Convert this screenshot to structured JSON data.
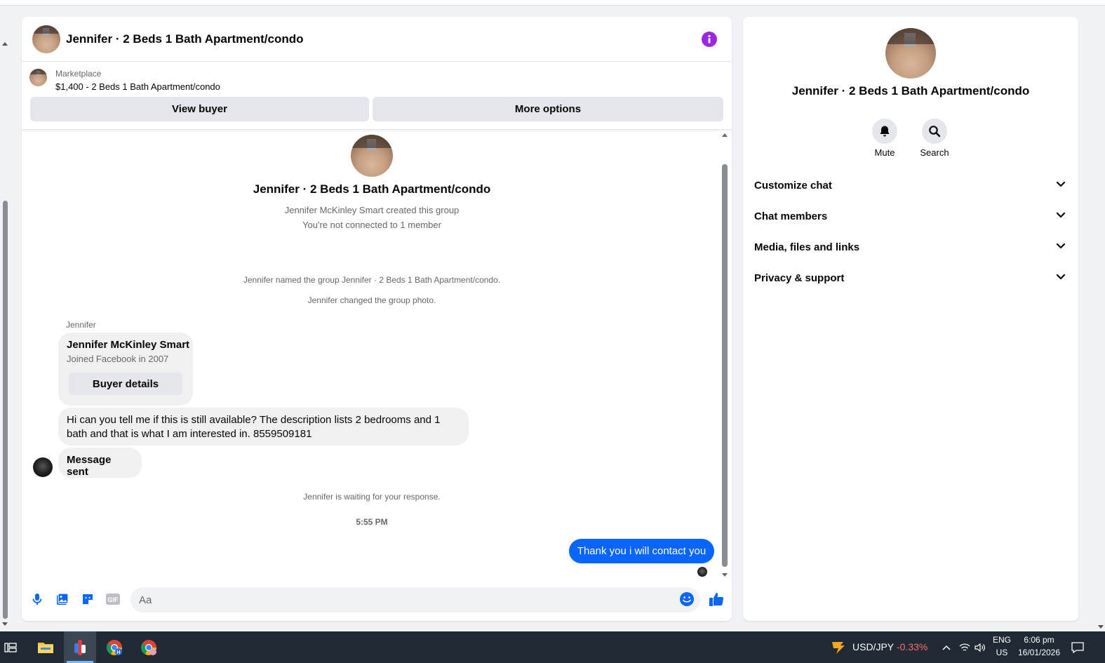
{
  "chat": {
    "title": "Jennifer · 2 Beds 1 Bath Apartment/condo",
    "listing": {
      "label": "Marketplace",
      "price_title": "$1,400 - 2 Beds 1 Bath Apartment/condo",
      "view_buyer": "View buyer",
      "more_options": "More options"
    },
    "intro": {
      "title": "Jennifer · 2 Beds 1 Bath Apartment/condo",
      "created": "Jennifer McKinley Smart created this group",
      "not_connected": "You're not connected to 1 member"
    },
    "events": {
      "named": "Jennifer named the group Jennifer · 2 Beds 1 Bath Apartment/condo.",
      "photo": "Jennifer changed the group photo."
    },
    "sender_name": "Jennifer",
    "buyer_card": {
      "name": "Jennifer McKinley Smart",
      "joined": "Joined Facebook in 2007",
      "button": "Buyer details"
    },
    "message_text": "Hi can you tell me if this is still available?  The description lists 2 bedrooms and 1 bath and that is what I am interested in. 8559509181",
    "message_sent": "Message sent",
    "waiting": "Jennifer is waiting for your response.",
    "time": "5:55 PM",
    "own_message": "Thank you i will contact you",
    "composer": {
      "placeholder": "Aa",
      "icons": [
        "microphone-icon",
        "photo-icon",
        "sticker-icon",
        "gif-icon",
        "emoji-icon",
        "like-icon"
      ]
    }
  },
  "sidebar": {
    "title": "Jennifer · 2 Beds 1 Bath Apartment/condo",
    "actions": [
      {
        "label": "Mute",
        "icon": "bell-icon"
      },
      {
        "label": "Search",
        "icon": "search-icon"
      }
    ],
    "sections": [
      {
        "label": "Customize chat"
      },
      {
        "label": "Chat members"
      },
      {
        "label": "Media, files and links"
      },
      {
        "label": "Privacy & support"
      }
    ]
  },
  "taskbar": {
    "ticker": "USD/JPY",
    "change": "-0.33%",
    "lang_top": "ENG",
    "lang_bottom": "US",
    "time": "6:06 pm",
    "date": "16/01/2026"
  },
  "colors": {
    "accent_blue": "#0866ff",
    "info_purple": "#9b28e0",
    "ticker_red": "#ff6b6b"
  }
}
